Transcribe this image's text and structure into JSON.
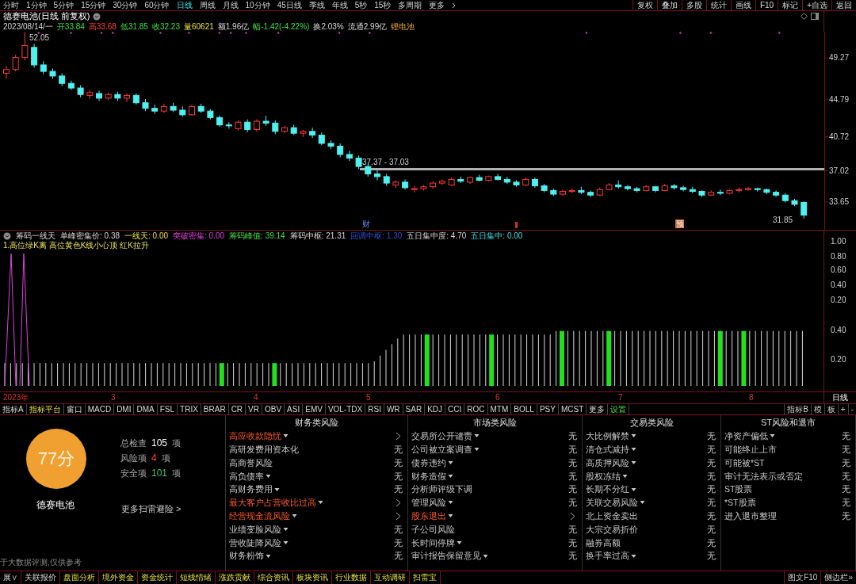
{
  "period_tabs": [
    {
      "label": "分时",
      "selected": false
    },
    {
      "label": "1分钟",
      "selected": false
    },
    {
      "label": "5分钟",
      "selected": false
    },
    {
      "label": "15分钟",
      "selected": false
    },
    {
      "label": "30分钟",
      "selected": false
    },
    {
      "label": "60分钟",
      "selected": false
    },
    {
      "label": "日线",
      "selected": true
    },
    {
      "label": "周线",
      "selected": false
    },
    {
      "label": "月线",
      "selected": false
    },
    {
      "label": "10分钟",
      "selected": false
    },
    {
      "label": "45日线",
      "selected": false
    },
    {
      "label": "季线",
      "selected": false
    },
    {
      "label": "年线",
      "selected": false
    },
    {
      "label": "5秒",
      "selected": false
    },
    {
      "label": "15秒",
      "selected": false
    },
    {
      "label": "多周期",
      "selected": false
    },
    {
      "label": "更多",
      "selected": false
    }
  ],
  "toolbar_buttons": [
    "复权",
    "叠加",
    "多股",
    "统计",
    "画线",
    "F10",
    "标记",
    "+自选",
    "返回"
  ],
  "chart": {
    "title": "德赛电池(日线 前复权)",
    "info": [
      {
        "text": "2023/08/14/一",
        "kind": "plain"
      },
      {
        "text": "开33.84",
        "kind": "down"
      },
      {
        "text": "高33.68",
        "kind": "up"
      },
      {
        "text": "低31.85",
        "kind": "down"
      },
      {
        "text": "收32.23",
        "kind": "down"
      },
      {
        "text": "量60621",
        "kind": "volume"
      },
      {
        "text": "额1.96亿",
        "kind": "plain"
      },
      {
        "text": "幅-1.42(-4.22%)",
        "kind": "down"
      },
      {
        "text": "换2.03%",
        "kind": "plain"
      },
      {
        "text": "流通2.99亿",
        "kind": "plain"
      },
      {
        "text": "锂电池",
        "kind": "tag"
      }
    ],
    "chart_data": {
      "type": "candlestick",
      "ylim": [
        30.64,
        52.1
      ],
      "yticks": [
        49.27,
        44.79,
        40.72,
        37.02,
        33.65
      ],
      "ohlc": [
        [
          47.6,
          48.4,
          47.0,
          48.0
        ],
        [
          48.0,
          49.6,
          47.8,
          49.3
        ],
        [
          49.3,
          52.05,
          49.0,
          50.6
        ],
        [
          50.4,
          50.8,
          48.2,
          48.5
        ],
        [
          48.5,
          48.9,
          47.5,
          47.8
        ],
        [
          47.8,
          48.1,
          47.0,
          47.3
        ],
        [
          47.3,
          47.6,
          46.2,
          46.5
        ],
        [
          46.5,
          46.8,
          45.8,
          46.0
        ],
        [
          46.0,
          46.3,
          45.0,
          45.3
        ],
        [
          45.2,
          45.8,
          44.8,
          45.5
        ],
        [
          45.4,
          45.7,
          44.6,
          44.9
        ],
        [
          44.9,
          45.5,
          44.7,
          45.3
        ],
        [
          45.3,
          45.6,
          44.6,
          44.9
        ],
        [
          44.9,
          45.4,
          44.5,
          45.2
        ],
        [
          45.2,
          45.4,
          44.2,
          44.4
        ],
        [
          44.4,
          44.8,
          43.5,
          43.8
        ],
        [
          43.8,
          44.2,
          43.2,
          43.5
        ],
        [
          43.5,
          44.3,
          43.3,
          44.0
        ],
        [
          44.0,
          44.4,
          43.4,
          43.6
        ],
        [
          43.6,
          44.0,
          42.9,
          43.1
        ],
        [
          43.1,
          44.2,
          43.0,
          44.0
        ],
        [
          44.0,
          44.3,
          43.3,
          43.5
        ],
        [
          43.5,
          43.7,
          42.6,
          42.8
        ],
        [
          42.8,
          43.0,
          41.8,
          42.0
        ],
        [
          42.0,
          42.3,
          41.6,
          41.9
        ],
        [
          41.6,
          42.5,
          41.4,
          42.3
        ],
        [
          42.3,
          42.6,
          41.2,
          41.5
        ],
        [
          41.5,
          42.6,
          41.3,
          42.4
        ],
        [
          42.4,
          43.0,
          41.9,
          42.2
        ],
        [
          42.2,
          42.5,
          41.0,
          41.3
        ],
        [
          41.3,
          41.9,
          41.1,
          41.7
        ],
        [
          41.7,
          42.0,
          40.9,
          41.1
        ],
        [
          41.1,
          41.5,
          40.7,
          41.3
        ],
        [
          41.3,
          41.7,
          40.6,
          40.9
        ],
        [
          40.9,
          41.2,
          39.8,
          40.0
        ],
        [
          40.0,
          40.3,
          39.4,
          39.7
        ],
        [
          39.7,
          40.0,
          38.5,
          38.8
        ],
        [
          38.8,
          39.2,
          38.1,
          38.4
        ],
        [
          38.4,
          38.7,
          37.2,
          37.5
        ],
        [
          37.5,
          37.8,
          36.4,
          36.7
        ],
        [
          36.7,
          37.1,
          36.0,
          36.4
        ],
        [
          36.4,
          36.7,
          35.4,
          35.7
        ],
        [
          35.5,
          36.0,
          35.2,
          35.8
        ],
        [
          35.8,
          36.1,
          35.0,
          35.2
        ],
        [
          35.0,
          35.4,
          34.7,
          35.1
        ],
        [
          35.1,
          35.5,
          34.9,
          35.3
        ],
        [
          35.3,
          35.9,
          35.1,
          35.7
        ],
        [
          35.7,
          36.1,
          35.5,
          35.9
        ],
        [
          35.5,
          36.3,
          35.4,
          36.1
        ],
        [
          36.1,
          36.4,
          35.7,
          35.9
        ],
        [
          35.8,
          36.4,
          35.6,
          36.3
        ],
        [
          36.3,
          36.6,
          35.9,
          36.0
        ],
        [
          36.0,
          36.5,
          35.9,
          36.4
        ],
        [
          36.4,
          36.7,
          36.0,
          36.1
        ],
        [
          36.1,
          36.4,
          35.6,
          35.8
        ],
        [
          35.8,
          36.0,
          35.3,
          35.5
        ],
        [
          35.5,
          36.3,
          35.4,
          36.1
        ],
        [
          36.1,
          36.3,
          35.2,
          35.4
        ],
        [
          35.4,
          35.6,
          34.7,
          34.9
        ],
        [
          34.9,
          35.1,
          34.3,
          34.5
        ],
        [
          34.5,
          35.0,
          34.3,
          34.8
        ],
        [
          34.8,
          35.1,
          34.6,
          34.9
        ],
        [
          34.9,
          35.3,
          34.5,
          34.7
        ],
        [
          34.7,
          34.9,
          34.2,
          34.4
        ],
        [
          34.4,
          35.2,
          34.3,
          35.0
        ],
        [
          35.0,
          35.7,
          34.9,
          35.5
        ],
        [
          35.5,
          36.0,
          35.1,
          35.3
        ],
        [
          35.3,
          35.5,
          34.9,
          35.1
        ],
        [
          35.1,
          35.3,
          34.7,
          34.9
        ],
        [
          34.9,
          35.5,
          34.8,
          35.3
        ],
        [
          35.3,
          35.4,
          34.7,
          34.9
        ],
        [
          34.9,
          35.6,
          34.8,
          35.4
        ],
        [
          35.4,
          35.6,
          35.0,
          35.2
        ],
        [
          35.2,
          35.4,
          34.8,
          35.0
        ],
        [
          35.0,
          35.3,
          34.6,
          34.8
        ],
        [
          34.8,
          34.9,
          34.2,
          34.4
        ],
        [
          34.4,
          34.9,
          34.3,
          34.7
        ],
        [
          34.7,
          35.0,
          34.4,
          34.6
        ],
        [
          34.6,
          35.0,
          34.5,
          34.9
        ],
        [
          34.9,
          35.2,
          34.7,
          35.0
        ],
        [
          35.0,
          35.3,
          34.9,
          35.1
        ],
        [
          35.1,
          35.2,
          34.8,
          35.0
        ],
        [
          35.0,
          35.1,
          34.5,
          34.7
        ],
        [
          34.7,
          34.9,
          34.2,
          34.4
        ],
        [
          34.4,
          34.6,
          33.6,
          33.8
        ],
        [
          33.8,
          34.0,
          33.2,
          33.4
        ],
        [
          33.6,
          33.7,
          31.85,
          32.23
        ]
      ]
    },
    "high_label": "52.05",
    "range_label": "37.37 - 37.03",
    "low_label": "31.85",
    "markers": [
      {
        "text": "财",
        "kind": "plain"
      },
      {
        "text": "预",
        "kind": "boxed"
      }
    ]
  },
  "indicator": {
    "header": [
      {
        "text": "筹码一线天",
        "kind": "plain"
      },
      {
        "text": "单峰密集价: 0.38",
        "kind": "plain"
      },
      {
        "text": "一线天: 0.00",
        "kind": "yellow"
      },
      {
        "text": "突破密集: 0.00",
        "kind": "magenta"
      },
      {
        "text": "筹码峰值: 39.14",
        "kind": "green"
      },
      {
        "text": "筹码中枢: 21.31",
        "kind": "plain"
      },
      {
        "text": "回调中枢: 1.30",
        "kind": "blue"
      },
      {
        "text": "五日集中度: 4.70",
        "kind": "plain"
      },
      {
        "text": "五日集中: 0.00",
        "kind": "cyan"
      }
    ],
    "legend": "1.高位绿K离 高位黄色K线小心顶 红K拉升",
    "axis_labels": [
      "1.00",
      "0.80",
      "0.60",
      "0.40",
      "0.20",
      "0.40",
      "0.20"
    ]
  },
  "date_axis": [
    "2023年",
    "3",
    "4",
    "5",
    "6",
    "7",
    "8"
  ],
  "date_period": "日线",
  "indicator_tabs": [
    {
      "label": "指标A",
      "kind": "plain"
    },
    {
      "label": "指标平台",
      "kind": "yellow"
    },
    {
      "label": "窗口",
      "kind": "plain"
    },
    {
      "label": "MACD",
      "kind": "plain"
    },
    {
      "label": "DMI",
      "kind": "plain"
    },
    {
      "label": "DMA",
      "kind": "plain"
    },
    {
      "label": "FSL",
      "kind": "plain"
    },
    {
      "label": "TRIX",
      "kind": "plain"
    },
    {
      "label": "BRAR",
      "kind": "plain"
    },
    {
      "label": "CR",
      "kind": "plain"
    },
    {
      "label": "VR",
      "kind": "plain"
    },
    {
      "label": "OBV",
      "kind": "plain"
    },
    {
      "label": "ASI",
      "kind": "plain"
    },
    {
      "label": "EMV",
      "kind": "plain"
    },
    {
      "label": "VOL-TDX",
      "kind": "plain"
    },
    {
      "label": "RSI",
      "kind": "plain"
    },
    {
      "label": "WR",
      "kind": "plain"
    },
    {
      "label": "SAR",
      "kind": "plain"
    },
    {
      "label": "KDJ",
      "kind": "plain"
    },
    {
      "label": "CCI",
      "kind": "plain"
    },
    {
      "label": "ROC",
      "kind": "plain"
    },
    {
      "label": "MTM",
      "kind": "plain"
    },
    {
      "label": "BOLL",
      "kind": "plain"
    },
    {
      "label": "PSY",
      "kind": "plain"
    },
    {
      "label": "MCST",
      "kind": "plain"
    },
    {
      "label": "更多",
      "kind": "plain"
    },
    {
      "label": "设置",
      "kind": "green"
    }
  ],
  "indicator_tabs_right": [
    "指标B",
    "模",
    "板",
    "+",
    "-"
  ],
  "risk": {
    "score": "77分",
    "stock": "德赛电池",
    "stats": [
      {
        "label": "总检查",
        "value": "105",
        "unit": "项",
        "kind": "white"
      },
      {
        "label": "风险项",
        "value": "4",
        "unit": "项",
        "kind": "red"
      },
      {
        "label": "安全项",
        "value": "101",
        "unit": "项",
        "kind": "teal"
      }
    ],
    "more_link": "更多扫雷避险 >",
    "disclaimer": "于大数据评测,仅供参考",
    "columns": [
      {
        "title": "财务类风险",
        "items": [
          {
            "name": "高应收款隐忧",
            "risk": true,
            "menu": true
          },
          {
            "name": "高研发费用资本化",
            "risk": false,
            "menu": false,
            "result": "无"
          },
          {
            "name": "高商誉风险",
            "risk": false,
            "menu": false,
            "result": "无"
          },
          {
            "name": "高负债率",
            "risk": false,
            "menu": true,
            "result": "无"
          },
          {
            "name": "高财务费用",
            "risk": false,
            "menu": true,
            "result": "无"
          },
          {
            "name": "最大客户占营收比过高",
            "risk": true,
            "menu": true
          },
          {
            "name": "经营现金流风险",
            "risk": true,
            "menu": true
          },
          {
            "name": "业绩变脸风险",
            "risk": false,
            "menu": true,
            "result": "无"
          },
          {
            "name": "营收陡降风险",
            "risk": false,
            "menu": true,
            "result": "无"
          },
          {
            "name": "财务粉饰",
            "risk": false,
            "menu": true,
            "result": "无"
          }
        ]
      },
      {
        "title": "市场类风险",
        "items": [
          {
            "name": "交易所公开谴责",
            "risk": false,
            "menu": true,
            "result": "无"
          },
          {
            "name": "公司被立案调查",
            "risk": false,
            "menu": true,
            "result": "无"
          },
          {
            "name": "债券违约",
            "risk": false,
            "menu": true,
            "result": "无"
          },
          {
            "name": "财务造假",
            "risk": false,
            "menu": true,
            "result": "无"
          },
          {
            "name": "分析师评级下调",
            "risk": false,
            "menu": false,
            "result": "无"
          },
          {
            "name": "管理风险",
            "risk": false,
            "menu": true,
            "result": "无"
          },
          {
            "name": "股东退出",
            "risk": true,
            "menu": true
          },
          {
            "name": "子公司风险",
            "risk": false,
            "menu": false,
            "result": "无"
          },
          {
            "name": "长时间停牌",
            "risk": false,
            "menu": true,
            "result": "无"
          },
          {
            "name": "审计报告保留意见",
            "risk": false,
            "menu": true,
            "result": "无"
          }
        ]
      },
      {
        "title": "交易类风险",
        "items": [
          {
            "name": "大比例解禁",
            "risk": false,
            "menu": true,
            "result": "无"
          },
          {
            "name": "清仓式减持",
            "risk": false,
            "menu": true,
            "result": "无"
          },
          {
            "name": "高质押风险",
            "risk": false,
            "menu": true,
            "result": "无"
          },
          {
            "name": "股权冻结",
            "risk": false,
            "menu": true,
            "result": "无"
          },
          {
            "name": "长期不分红",
            "risk": false,
            "menu": true,
            "result": "无"
          },
          {
            "name": "关联交易风险",
            "risk": false,
            "menu": true,
            "result": "无"
          },
          {
            "name": "北上资金卖出",
            "risk": false,
            "menu": false,
            "result": "无"
          },
          {
            "name": "大宗交易折价",
            "risk": false,
            "menu": false,
            "result": "无"
          },
          {
            "name": "融券高额",
            "risk": false,
            "menu": false,
            "result": "无"
          },
          {
            "name": "换手率过高",
            "risk": false,
            "menu": true,
            "result": "无"
          }
        ]
      },
      {
        "title": "ST风险和退市",
        "items": [
          {
            "name": "净资产偏低",
            "risk": false,
            "menu": true,
            "result": "无"
          },
          {
            "name": "可能终止上市",
            "risk": false,
            "menu": false,
            "result": "无"
          },
          {
            "name": "可能被*ST",
            "risk": false,
            "menu": false,
            "result": "无"
          },
          {
            "name": "审计无法表示或否定",
            "risk": false,
            "menu": false,
            "result": "无"
          },
          {
            "name": "ST股票",
            "risk": false,
            "menu": false,
            "result": "无"
          },
          {
            "name": "*ST股票",
            "risk": false,
            "menu": false,
            "result": "无"
          },
          {
            "name": "进入退市整理",
            "risk": false,
            "menu": false,
            "result": "无"
          }
        ]
      }
    ]
  },
  "bottom_tabs": [
    {
      "label": "展∨",
      "kind": "plain"
    },
    {
      "label": "关联报价",
      "kind": "plain"
    },
    {
      "label": "盘面分析",
      "kind": "yellow"
    },
    {
      "label": "境外资金",
      "kind": "yellow"
    },
    {
      "label": "资金统计",
      "kind": "yellow"
    },
    {
      "label": "短线情绪",
      "kind": "yellow"
    },
    {
      "label": "涨跌贡献",
      "kind": "yellow"
    },
    {
      "label": "综合资讯",
      "kind": "yellow"
    },
    {
      "label": "板块资讯",
      "kind": "yellow"
    },
    {
      "label": "行业数据",
      "kind": "yellow"
    },
    {
      "label": "互动调研",
      "kind": "yellow"
    },
    {
      "label": "扫雷宝",
      "kind": "yellow"
    }
  ],
  "bottom_right": [
    "图文F10",
    "侧边栏»"
  ]
}
